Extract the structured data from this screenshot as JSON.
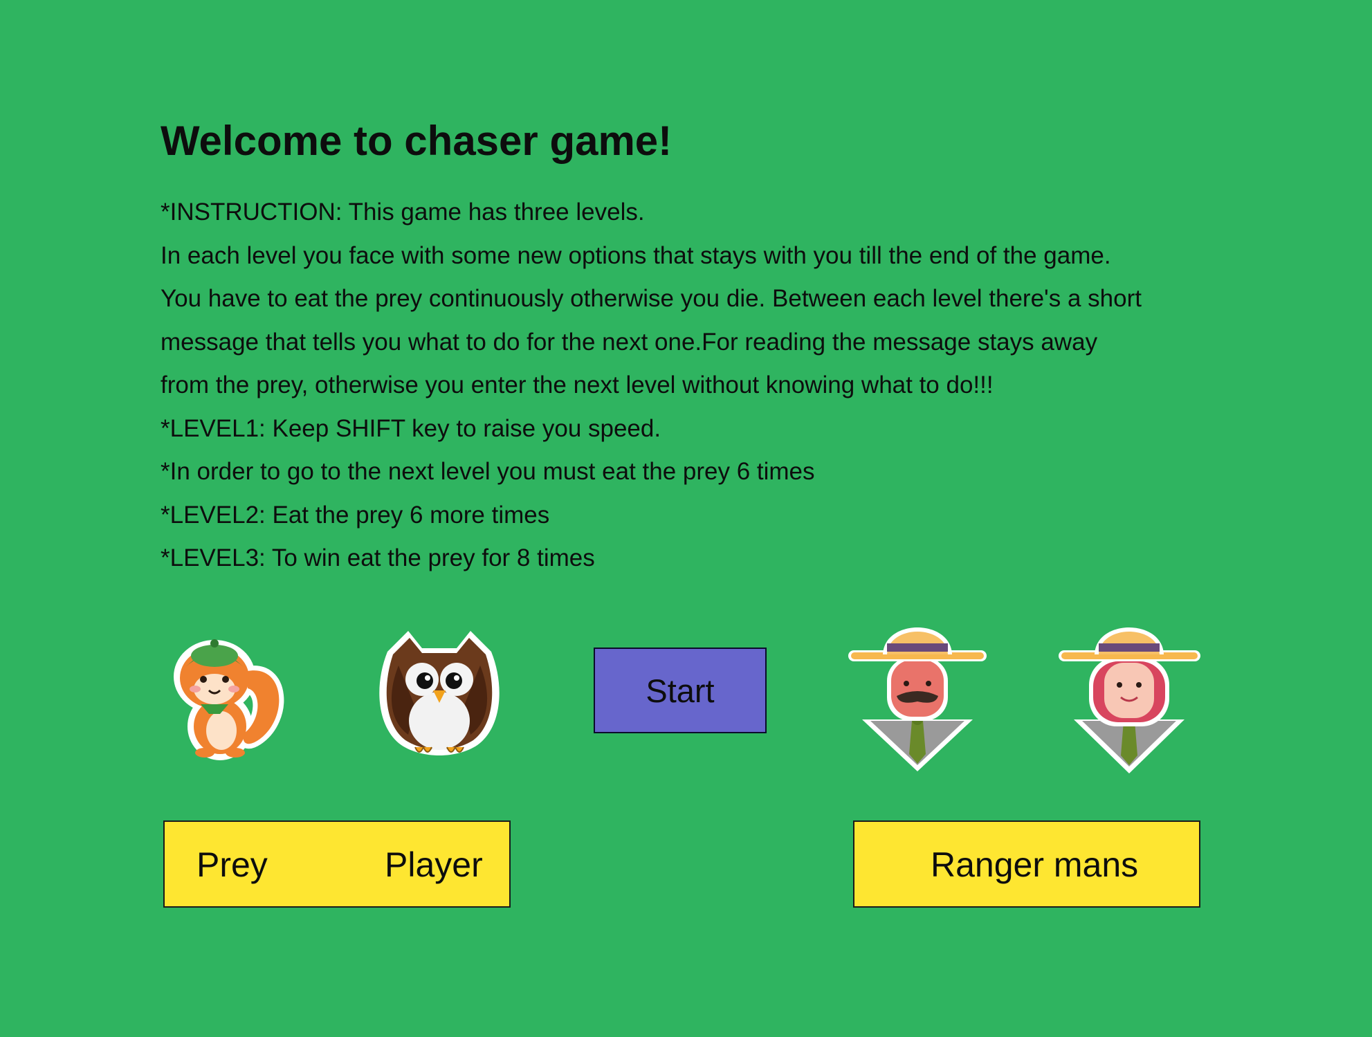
{
  "title": "Welcome to chaser game!",
  "instructions": [
    "*INSTRUCTION: This game has three levels.",
    "In each level you face with some new options that stays with you till the end of the game.",
    "You have to eat the prey continuously otherwise you die. Between each level there's a short",
    "message that tells you what to do for the next one.For reading the message stays away",
    "from the prey, otherwise you enter the next level without knowing what to do!!!",
    "*LEVEL1: Keep SHIFT key to raise you speed.",
    "*In order to go to the next level you must eat the prey 6 times",
    "*LEVEL2: Eat the prey 6 more times",
    "*LEVEL3: To win eat the prey for 8 times"
  ],
  "start_button": {
    "label": "Start"
  },
  "labels": {
    "prey": "Prey",
    "player": "Player",
    "rangers": "Ranger mans"
  },
  "characters": [
    {
      "name": "squirrel-icon",
      "role": "prey"
    },
    {
      "name": "owl-icon",
      "role": "player"
    },
    {
      "name": "male-ranger-icon",
      "role": "ranger"
    },
    {
      "name": "female-ranger-icon",
      "role": "ranger"
    }
  ],
  "colors": {
    "background": "#2fb460",
    "start_button": "#6766cc",
    "label_box": "#fee631"
  }
}
